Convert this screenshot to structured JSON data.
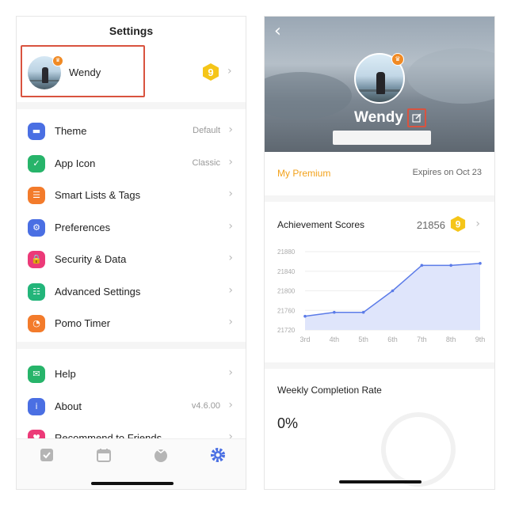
{
  "left_screen": {
    "title": "Settings",
    "profile": {
      "name": "Wendy",
      "level_badge": "9"
    },
    "menu": [
      {
        "label": "Theme",
        "value": "Default",
        "icon": "theme-icon",
        "color": "#4a6fe3"
      },
      {
        "label": "App Icon",
        "value": "Classic",
        "icon": "app-icon-check-icon",
        "color": "#27b46a"
      },
      {
        "label": "Smart Lists & Tags",
        "value": "",
        "icon": "smart-lists-icon",
        "color": "#f37b2b"
      },
      {
        "label": "Preferences",
        "value": "",
        "icon": "preferences-gear-icon",
        "color": "#4a6fe3"
      },
      {
        "label": "Security & Data",
        "value": "",
        "icon": "lock-icon",
        "color": "#ec3a78"
      },
      {
        "label": "Advanced Settings",
        "value": "",
        "icon": "sliders-icon",
        "color": "#23b57a"
      },
      {
        "label": "Pomo Timer",
        "value": "",
        "icon": "pomo-timer-icon",
        "color": "#f37b2b"
      }
    ],
    "menu2": [
      {
        "label": "Help",
        "value": "",
        "icon": "help-chat-icon",
        "color": "#27b46a"
      },
      {
        "label": "About",
        "value": "v4.6.00",
        "icon": "info-icon",
        "color": "#4a6fe3"
      },
      {
        "label": "Recommend to Friends",
        "value": "",
        "icon": "recommend-icon",
        "color": "#ec3a78"
      }
    ],
    "tabbar": [
      "tasks-checkbox-icon",
      "calendar-icon",
      "pomo-icon",
      "settings-gear-icon"
    ]
  },
  "right_screen": {
    "profile_name": "Wendy",
    "premium": {
      "label": "My Premium",
      "expires": "Expires on Oct 23"
    },
    "achievement": {
      "title": "Achievement Scores",
      "score": "21856",
      "level_badge": "9"
    },
    "weekly": {
      "title": "Weekly Completion Rate",
      "value": "0%"
    }
  },
  "colors": {
    "accent_blue": "#4a6fe3",
    "premium_orange": "#f3a21b",
    "highlight_red": "#d9533f",
    "badge_yellow": "#f5c518"
  },
  "chart_data": {
    "type": "area",
    "x": [
      "3rd",
      "4th",
      "5th",
      "6th",
      "7th",
      "8th",
      "9th"
    ],
    "series": [
      {
        "values": [
          21748,
          21756,
          21756,
          21800,
          21852,
          21852,
          21856
        ]
      }
    ],
    "y_ticks": [
      "21880",
      "21840",
      "21800",
      "21760",
      "21720"
    ],
    "ylim": [
      21720,
      21880
    ],
    "grid": true,
    "line_color": "#5b7be8",
    "fill_color": "#dfe5fb"
  }
}
